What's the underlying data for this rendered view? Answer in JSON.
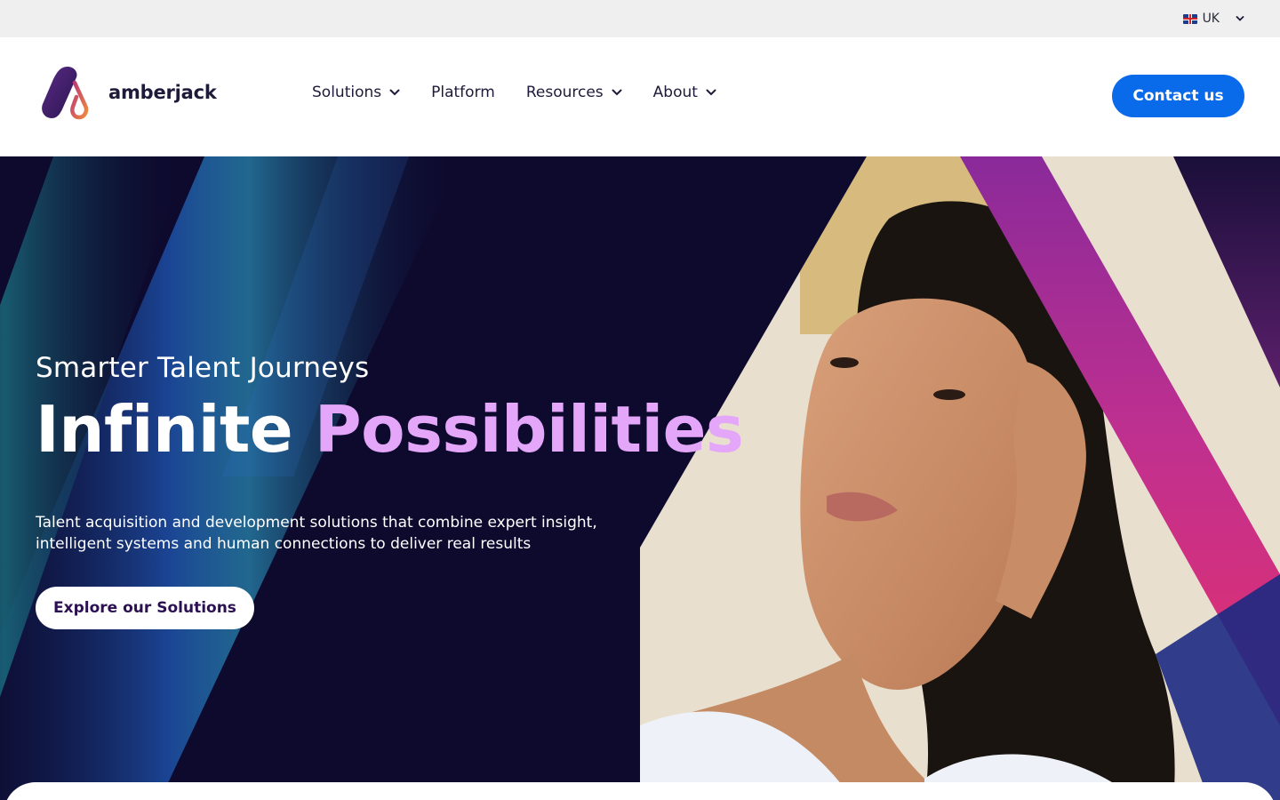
{
  "topbar": {
    "region_label": "UK",
    "region_flag": "uk-flag-icon"
  },
  "header": {
    "brand_name": "amberjack",
    "nav": [
      {
        "label": "Solutions",
        "has_dropdown": true
      },
      {
        "label": "Platform",
        "has_dropdown": false
      },
      {
        "label": "Resources",
        "has_dropdown": true
      },
      {
        "label": "About",
        "has_dropdown": true
      }
    ],
    "contact_label": "Contact us"
  },
  "hero": {
    "eyebrow": "Smarter Talent Journeys",
    "headline_part1": "Infinite",
    "headline_part2": "Possibilities",
    "description": "Talent acquisition and development solutions that combine expert insight, intelligent systems and human connections to deliver real results",
    "cta_label": "Explore our Solutions"
  },
  "colors": {
    "accent_blue": "#0a6bea",
    "hero_bg": "#0d0a2e",
    "headline_highlight": "#e3a6f8",
    "brand_dark": "#1e1a3a"
  }
}
